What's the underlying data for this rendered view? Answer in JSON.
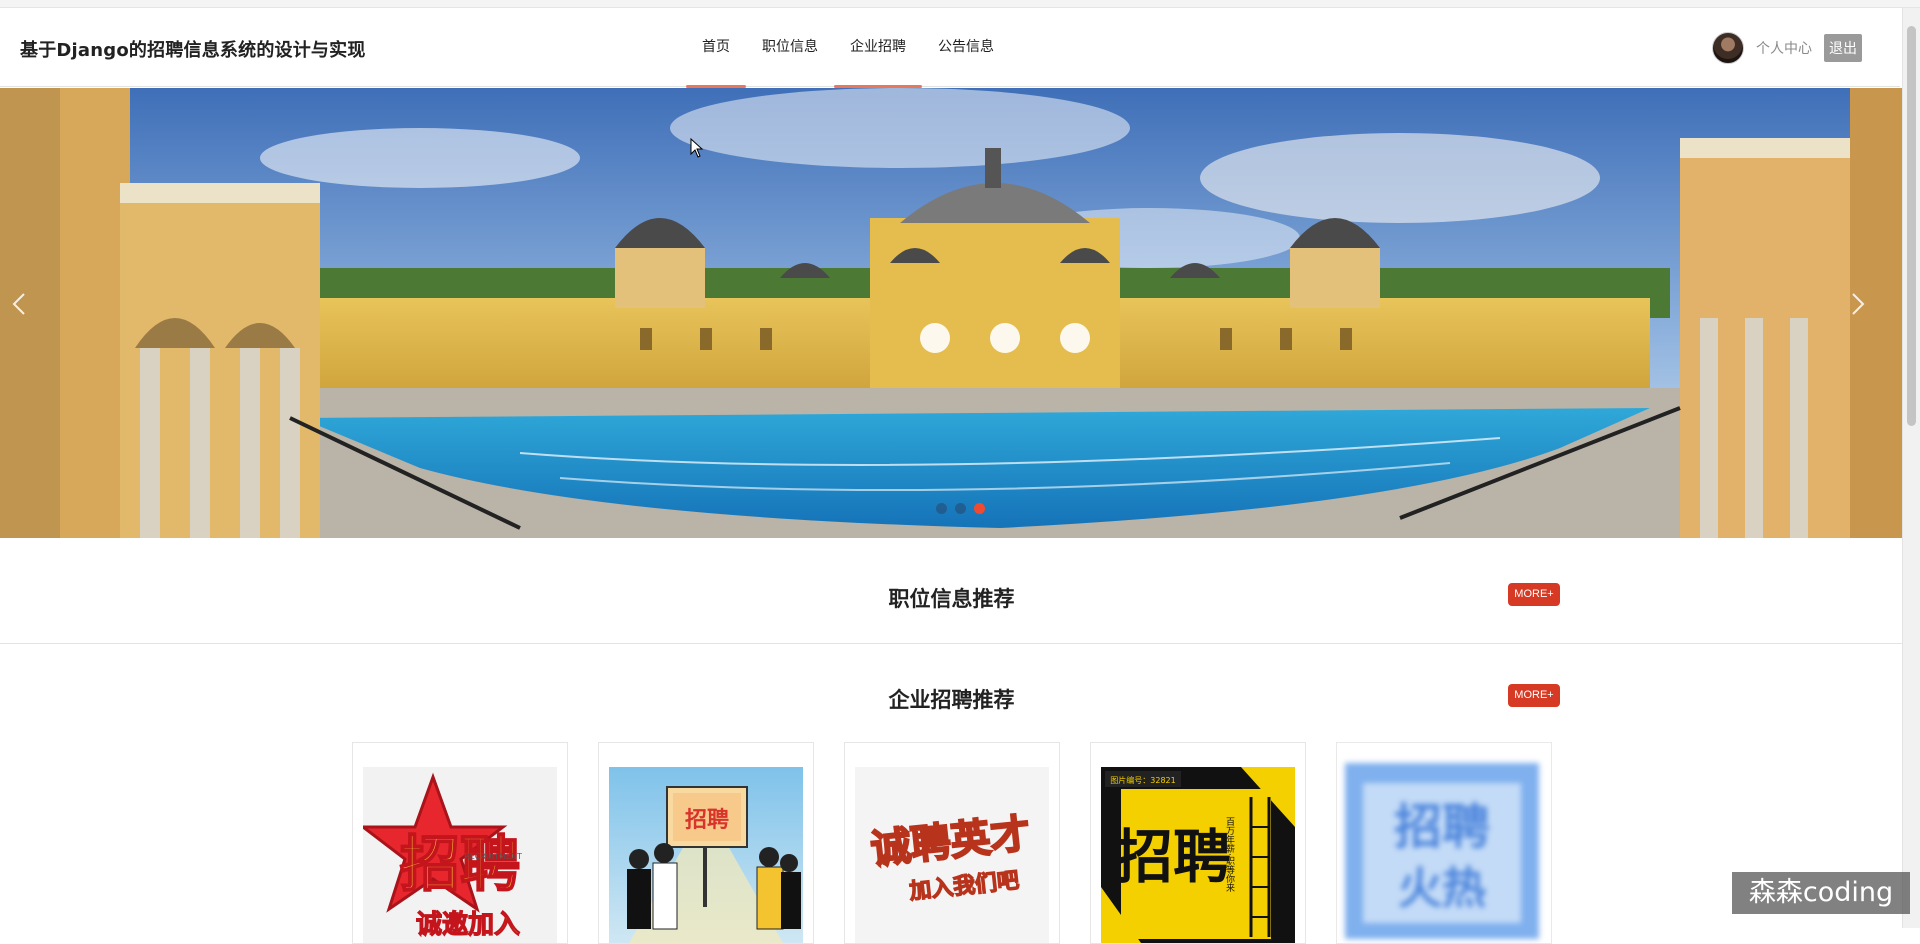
{
  "header": {
    "site_title": "基于Django的招聘信息系统的设计与实现",
    "nav": [
      {
        "label": "首页",
        "active": true
      },
      {
        "label": "职位信息",
        "active": false
      },
      {
        "label": "企业招聘",
        "active": true
      },
      {
        "label": "公告信息",
        "active": false
      }
    ],
    "user_center": "个人中心",
    "logout": "退出"
  },
  "banner": {
    "prev_icon": "chevron-left-icon",
    "next_icon": "chevron-right-icon",
    "dot_count": 3,
    "active_dot": 3
  },
  "sections": {
    "job_title": "职位信息推荐",
    "company_title": "企业招聘推荐",
    "more_label": "MORE+"
  },
  "company_cards": [
    {
      "poster_text": "招聘",
      "poster_sub": "诚邀加入",
      "poster_en": "RECRUITMENT"
    },
    {
      "poster_text": "招聘"
    },
    {
      "poster_text": "诚聘英才",
      "poster_sub": "加入我们吧"
    },
    {
      "poster_text": "招聘",
      "poster_sub": "百万年薪·职等你来",
      "poster_tag": "图片编号：32821"
    },
    {
      "poster_text": "招聘",
      "poster_sub": "火热"
    }
  ],
  "watermark": "森森coding",
  "colors": {
    "accent": "#e8785a",
    "more": "#d63a24",
    "active_dot": "#ef4b33"
  }
}
